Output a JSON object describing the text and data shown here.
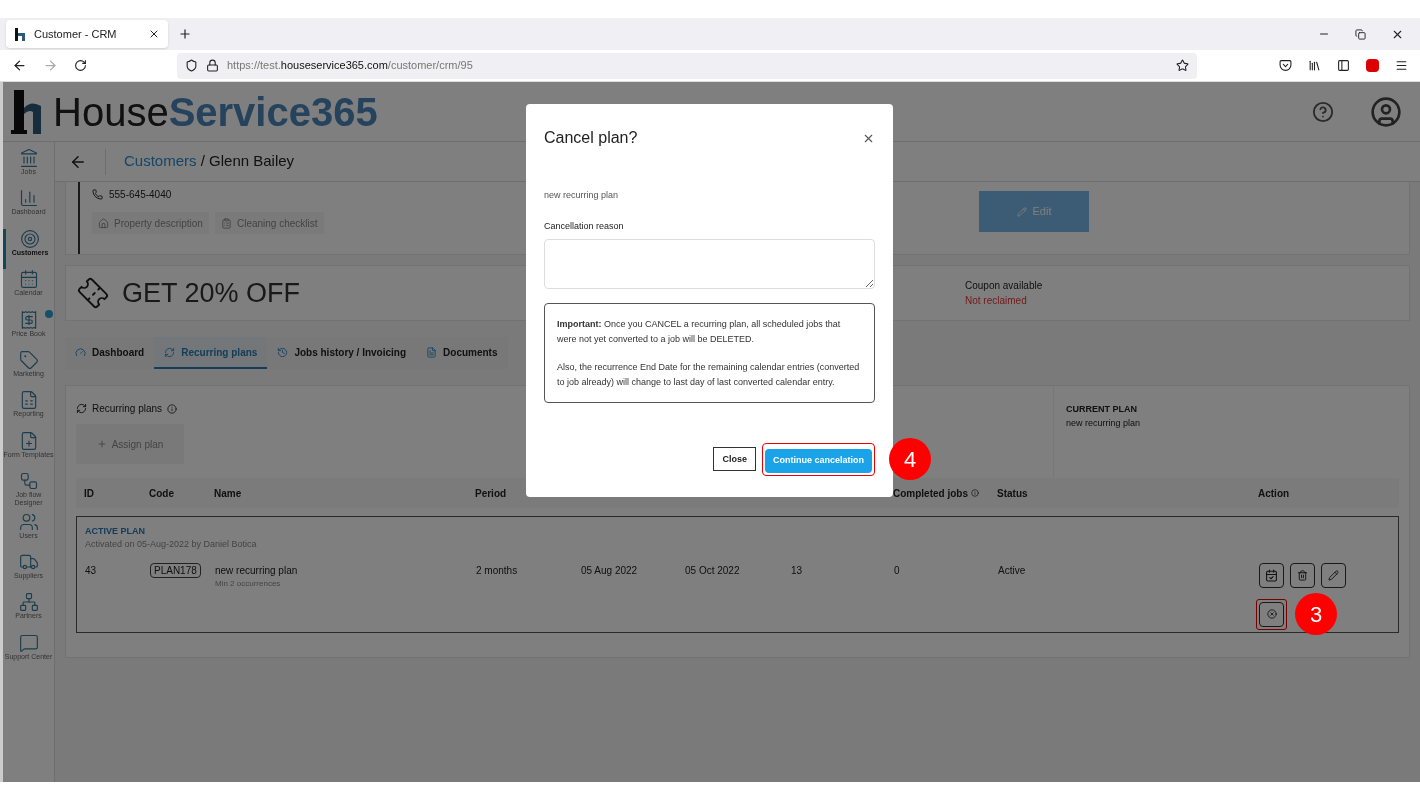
{
  "browser": {
    "tab_title": "Customer - CRM",
    "url_prefix": "https://test.",
    "url_domain": "houseservice365.com",
    "url_path": "/customer/crm/95"
  },
  "header": {
    "logo_part1": "House",
    "logo_part2": "Service365"
  },
  "sidebar": {
    "items": [
      {
        "label": "Jobs",
        "selected": false,
        "add_badge": false
      },
      {
        "label": "Dashboard",
        "selected": false,
        "add_badge": false
      },
      {
        "label": "Customers",
        "selected": true,
        "add_badge": false
      },
      {
        "label": "Calendar",
        "selected": false,
        "add_badge": false
      },
      {
        "label": "Price Book",
        "selected": false,
        "add_badge": true
      },
      {
        "label": "Marketing",
        "selected": false,
        "add_badge": false
      },
      {
        "label": "Reporting",
        "selected": false,
        "add_badge": false
      },
      {
        "label": "Form Templates",
        "selected": false,
        "add_badge": false
      },
      {
        "label": "Job flow Designer",
        "selected": false,
        "add_badge": false
      },
      {
        "label": "Users",
        "selected": false,
        "add_badge": false
      },
      {
        "label": "Suppliers",
        "selected": false,
        "add_badge": false
      },
      {
        "label": "Partners",
        "selected": false,
        "add_badge": false
      },
      {
        "label": "Support Center",
        "selected": false,
        "add_badge": false
      }
    ]
  },
  "breadcrumb": {
    "parent": "Customers",
    "separator": "/",
    "current": "Glenn Bailey"
  },
  "customer_card": {
    "phone": "555-645-4040",
    "buttons": [
      "Property description",
      "Cleaning checklist"
    ],
    "edit_button": "Edit"
  },
  "coupon": {
    "title": "GET 20% OFF",
    "label": "Coupon available",
    "status": "Not reclaimed"
  },
  "tabs": [
    {
      "label": "Dashboard",
      "selected": false
    },
    {
      "label": "Recurring plans",
      "selected": true
    },
    {
      "label": "Jobs history / Invoicing",
      "selected": false
    },
    {
      "label": "Documents",
      "selected": false
    }
  ],
  "recurring": {
    "title": "Recurring plans",
    "assign_button": "Assign plan",
    "current_plan_label": "CURRENT PLAN",
    "current_plan_name": "new recurring plan",
    "table": {
      "columns": [
        "ID",
        "Code",
        "Name",
        "Period",
        "Completed jobs",
        "Status",
        "Action"
      ],
      "group": {
        "title": "ACTIVE PLAN",
        "subtitle": "Activated on 05-Aug-2022 by Daniel Botica"
      },
      "rows": [
        {
          "id": "43",
          "code": "PLAN178",
          "name": "new recurring plan",
          "note": "Min 2 occurrences",
          "period": "2 months",
          "column_5": "05 Aug 2022",
          "column_6": "05 Oct 2022",
          "column_7": "13",
          "completed": "0",
          "status": "Active"
        }
      ]
    }
  },
  "modal": {
    "title": "Cancel plan?",
    "plan_name": "new recurring plan",
    "reason_label": "Cancellation reason",
    "notice": [
      "**Important:** Once you CANCEL a recurring plan, all scheduled jobs that were not yet converted to a job will be DELETED.",
      "Also, the recurrence End Date for the remaining calendar entries (converted to job already) will change to last day of last converted calendar entry."
    ],
    "close_button": "Close",
    "confirm_button": "Continue cancelation"
  },
  "annotations": [
    {
      "label": "4"
    },
    {
      "label": "3"
    }
  ]
}
